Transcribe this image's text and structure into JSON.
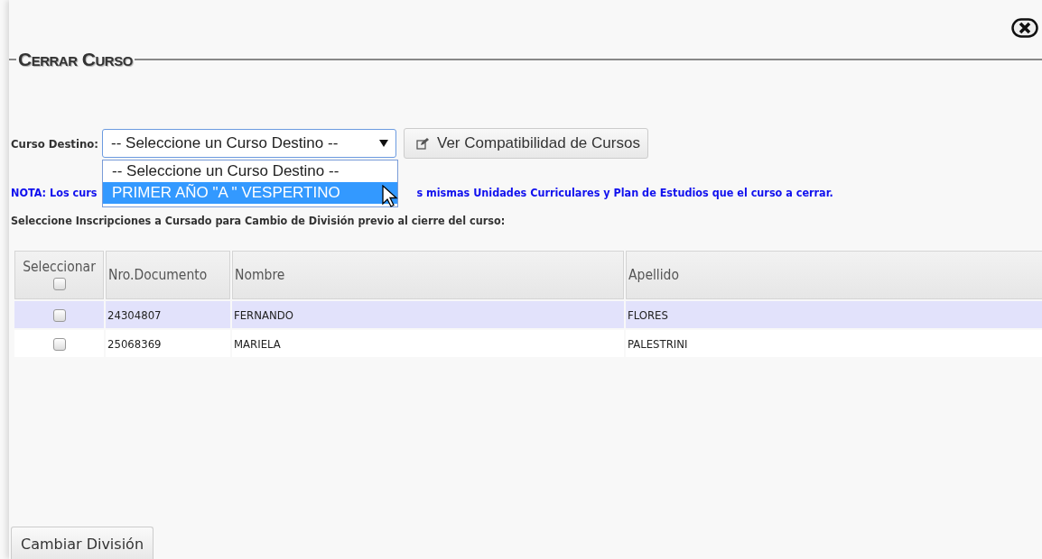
{
  "title": "Cerrar Curso",
  "destino": {
    "label": "Curso Destino:",
    "value": "-- Seleccione un Curso Destino --",
    "expanded": true,
    "options": [
      {
        "label": "-- Seleccione un Curso Destino --",
        "highlighted": false
      },
      {
        "label": "PRIMER AÑO \"A \" VESPERTINO",
        "highlighted": true
      }
    ]
  },
  "compat_button": "Ver Compatibilidad de Cursos",
  "note": {
    "start": "NOTA: Los curs",
    "end": "s mismas Unidades Curriculares y Plan de Estudios que el curso a cerrar."
  },
  "subtitle": "Seleccione Inscripciones a Cursado para Cambio de División previo al cierre del curso:",
  "table": {
    "columns": [
      "Seleccionar",
      "Nro.Documento",
      "Nombre",
      "Apellido"
    ],
    "select_all_checked": false,
    "rows": [
      {
        "documento": "24304807",
        "nombre": "FERNANDO",
        "apellido": "FLORES",
        "checked": false,
        "highlighted": true
      },
      {
        "documento": "25068369",
        "nombre": "MARIELA",
        "apellido": "PALESTRINI",
        "checked": false,
        "highlighted": false
      }
    ]
  },
  "action_button": "Cambiar División"
}
